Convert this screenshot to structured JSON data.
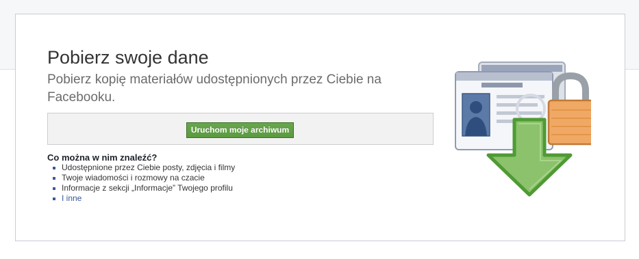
{
  "header": {
    "title": "Pobierz swoje dane",
    "subtitle": "Pobierz kopię materiałów udostępnionych przez Ciebie na Facebooku."
  },
  "action": {
    "start_archive_label": "Uruchom moje archiwum"
  },
  "contents": {
    "heading": "Co można w nim znaleźć?",
    "items": [
      "Udostępnione przez Ciebie posty, zdjęcia i filmy",
      "Twoje wiadomości i rozmowy na czacie",
      "Informacje z sekcji „Informacje” Twojego profilu"
    ],
    "more_link": "I inne"
  },
  "illustration": {
    "icons": [
      "profile-card-icon",
      "padlock-icon",
      "download-arrow-icon"
    ]
  },
  "colors": {
    "button": "#5b9a40",
    "arrow": "#8cc26b",
    "lock": "#f0a965",
    "link": "#365899"
  }
}
